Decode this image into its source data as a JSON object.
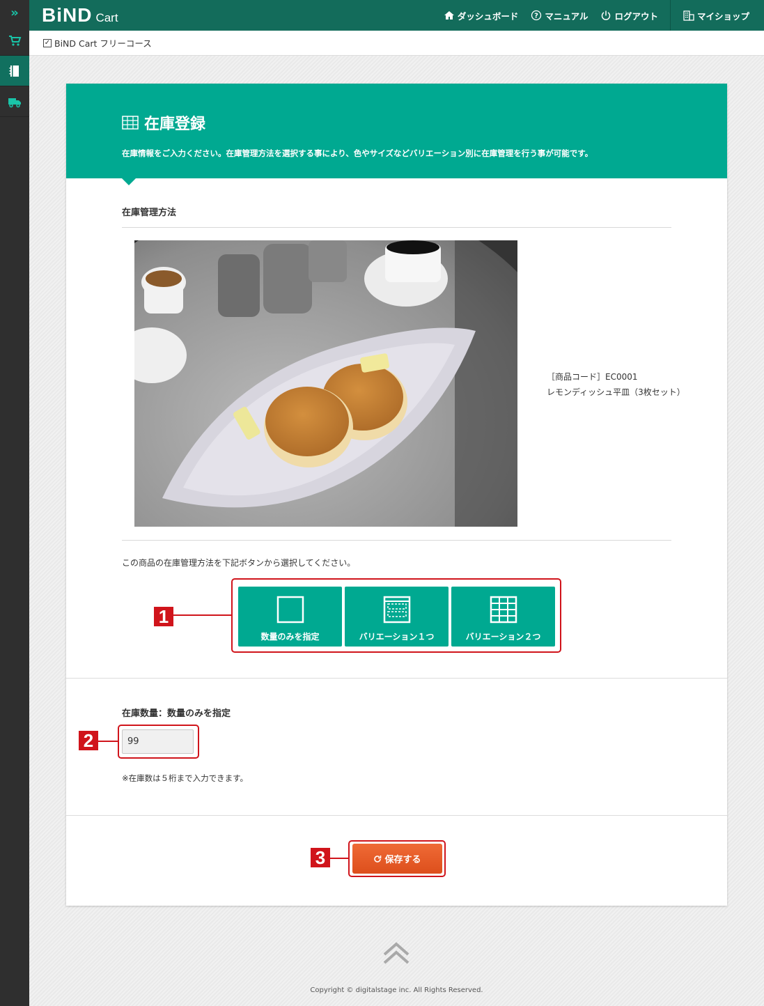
{
  "header": {
    "logo_main": "BiND",
    "logo_sub": "Cart",
    "nav": {
      "dashboard": "ダッシュボード",
      "manual": "マニュアル",
      "logout": "ログアウト",
      "myshop": "マイショップ"
    }
  },
  "subbar": {
    "course": "BiND Cart フリーコース"
  },
  "card": {
    "title": "在庫登録",
    "description": "在庫情報をご入力ください。在庫管理方法を選択する事により、色やサイズなどバリエーション別に在庫管理を行う事が可能です。",
    "method_label": "在庫管理方法",
    "product_code": "［商品コード］EC0001",
    "product_name": "レモンディッシュ平皿（3枚セット）",
    "instruction": "この商品の在庫管理方法を下記ボタンから選択してください。",
    "methods": [
      {
        "label": "数量のみを指定",
        "icon": "square-icon"
      },
      {
        "label": "バリエーション１つ",
        "icon": "single-variation-icon"
      },
      {
        "label": "バリエーション２つ",
        "icon": "grid-icon"
      }
    ],
    "qty_label": "在庫数量：数量のみを指定",
    "qty_value": "99",
    "qty_note": "※在庫数は５桁まで入力できます。",
    "save_label": "保存する"
  },
  "annotations": [
    "1",
    "2",
    "3"
  ],
  "footer": {
    "copyright": "Copyright © digitalstage inc. All Rights Reserved."
  },
  "colors": {
    "header": "#136c5b",
    "accent": "#00a991",
    "save": "#e05a23",
    "annotation": "#d0141b",
    "rail": "#2f2f2f"
  }
}
